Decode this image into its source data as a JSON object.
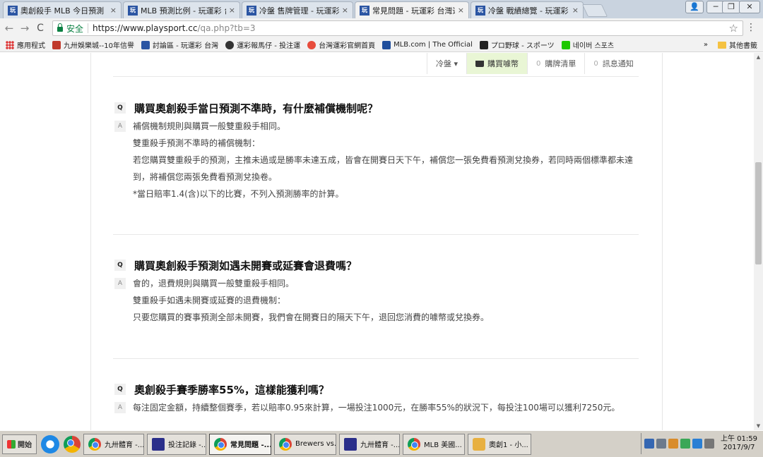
{
  "tabs": [
    {
      "label": "奧創殺手 MLB 今日預測",
      "favicon": "玩",
      "active": false
    },
    {
      "label": "MLB 預測比例 - 玩運彩 台",
      "favicon": "玩",
      "active": false
    },
    {
      "label": "冷盤 售牌管理 - 玩運彩 台",
      "favicon": "玩",
      "active": false
    },
    {
      "label": "常見問題 - 玩運彩 台灣運",
      "favicon": "玩",
      "active": true
    },
    {
      "label": "冷盤 戰績總覽 - 玩運彩 台",
      "favicon": "玩",
      "active": false
    }
  ],
  "tab_close": "×",
  "window_controls": {
    "user": "👤",
    "minimize": "─",
    "restore": "❐",
    "close": "✕"
  },
  "addressbar": {
    "back": "←",
    "forward": "→",
    "reload": "C",
    "secure_label": "安全",
    "url_host": "https://www.playsport.cc",
    "url_path": "/qa.php?tb=3",
    "bookmark_star": "☆",
    "menu": "⋮"
  },
  "bookmarks": {
    "apps_label": "應用程式",
    "items": [
      {
        "label": "九卅娛樂城--10年信譽",
        "color": "#c0392b"
      },
      {
        "label": "討論區 - 玩運彩 台灣",
        "color": "#2b55a3"
      },
      {
        "label": "運彩報馬仔 - 投注運",
        "color": "#333333"
      },
      {
        "label": "台灣運彩官網首頁",
        "color": "#e74c3c"
      },
      {
        "label": "MLB.com | The Official",
        "color": "#1f4e9c"
      },
      {
        "label": "プロ野球 - スポーツ",
        "color": "#222222"
      },
      {
        "label": "네이버 스포츠",
        "color": "#1ec800"
      }
    ],
    "more": "»",
    "other_label": "其他書籤"
  },
  "subnav": {
    "dropdown_label": "冷盤 ▾",
    "buy_label": "購買噱幣",
    "cart_count": "0",
    "cart_label": "購牌清單",
    "msg_count": "0",
    "msg_label": "訊息通知"
  },
  "faq": [
    {
      "q_badge": "Q",
      "question": "購買奧創殺手當日預測不準時，有什麼補償機制呢？",
      "a_badge": "A",
      "answer": [
        "補償機制規則與購買一般雙重殺手相同。",
        "雙重殺手預測不準時的補償機制：",
        "若您購買雙重殺手的預測，主推未過或是勝率未達五成，皆會在開賽日天下午，補償您一張免費看預測兌換券，若同時兩個標準都未達到，將補償您兩張免費看預測兌換卷。",
        "*當日賠率1.4(含)以下的比賽，不列入預測勝率的計算。"
      ]
    },
    {
      "q_badge": "Q",
      "question": "購買奧創殺手預測如遇未開賽或延賽會退費嗎？",
      "a_badge": "A",
      "answer": [
        "會的，退費規則與購買一般雙重殺手相同。",
        "雙重殺手如遇未開賽或延賽的退費機制：",
        "只要您購買的賽事預測全部未開賽，我們會在開賽日的隔天下午，退回您消費的噱幣或兌換券。"
      ]
    },
    {
      "q_badge": "Q",
      "question": "奧創殺手賽季勝率55%，這樣能獲利嗎？",
      "a_badge": "A",
      "answer": [
        "每注固定金額，持續整個賽季，若以賠率0.95來計算，一場投注1000元，在勝率55%的狀況下，每投注100場可以獲利7250元。"
      ]
    }
  ],
  "taskbar": {
    "start_label": "開始",
    "buttons": [
      {
        "label": "九卅體育 -...",
        "icon": "chrome",
        "active": false
      },
      {
        "label": "投注記錄 -...",
        "icon": "square",
        "active": false
      },
      {
        "label": "常見問題 -...",
        "icon": "chrome",
        "active": true
      },
      {
        "label": "Brewers vs....",
        "icon": "chrome",
        "active": false
      },
      {
        "label": "九卅體育 -...",
        "icon": "square",
        "active": false
      },
      {
        "label": "MLB 美國...",
        "icon": "chrome",
        "active": false
      },
      {
        "label": "奧創1 - 小...",
        "icon": "paint",
        "active": false
      }
    ],
    "clock_time": "上午 01:59",
    "clock_date": "2017/9/7"
  }
}
